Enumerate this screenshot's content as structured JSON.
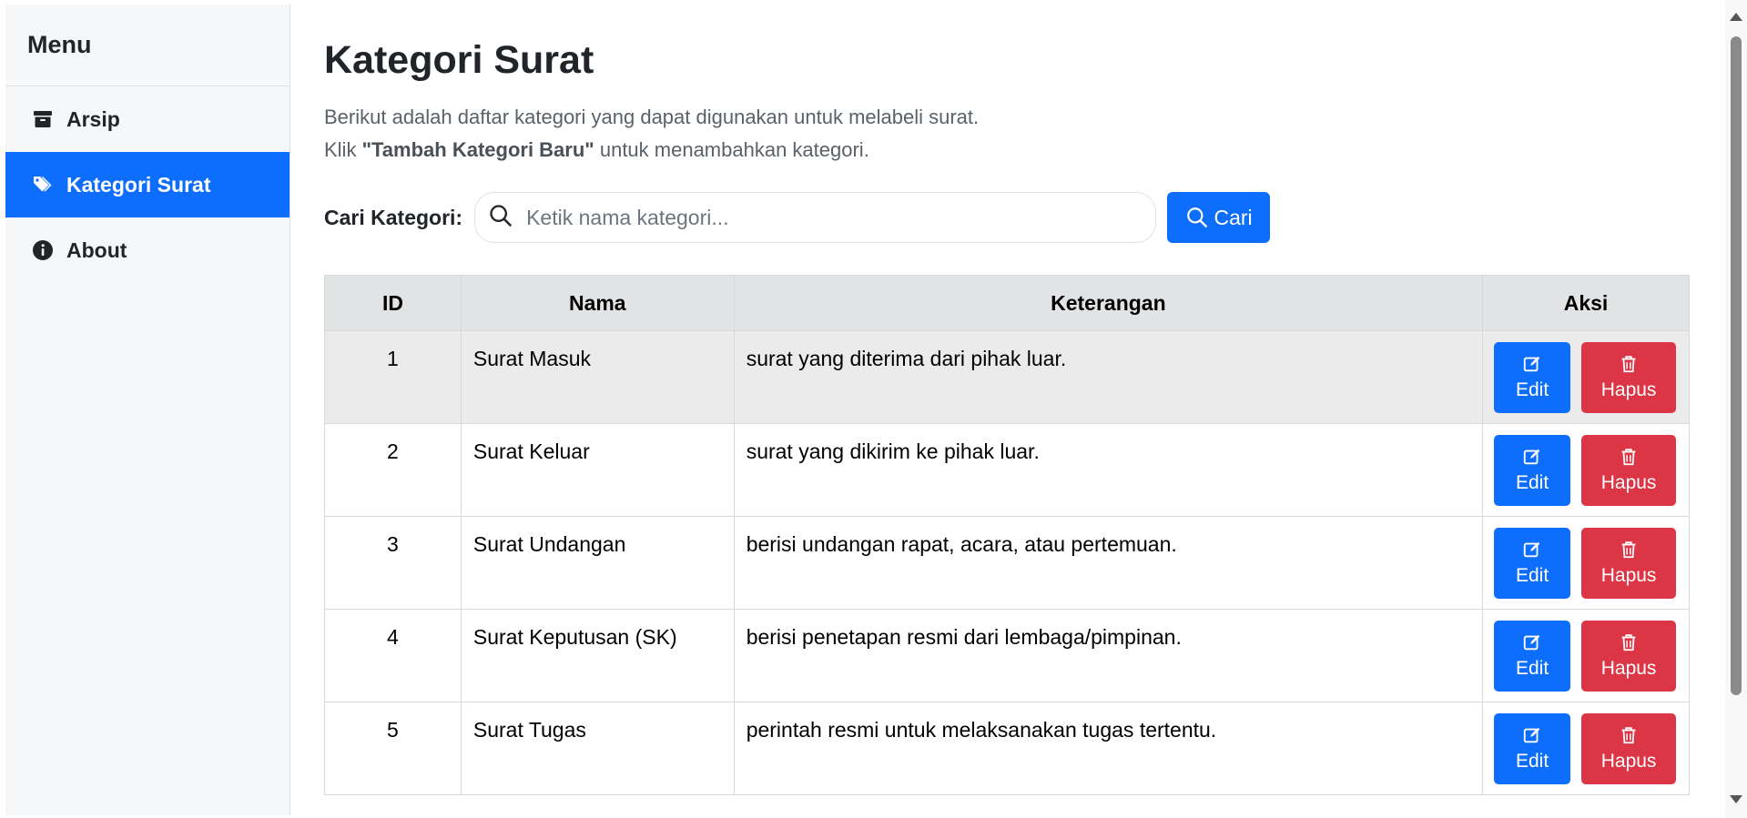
{
  "sidebar": {
    "title": "Menu",
    "items": [
      {
        "label": "Arsip",
        "icon": "archive-icon",
        "active": false
      },
      {
        "label": "Kategori Surat",
        "icon": "tags-icon",
        "active": true
      },
      {
        "label": "About",
        "icon": "info-icon",
        "active": false
      }
    ]
  },
  "main": {
    "title": "Kategori Surat",
    "description_line1": "Berikut adalah daftar kategori yang dapat digunakan untuk melabeli surat.",
    "description_line2_prefix": "Klik ",
    "description_line2_bold": "\"Tambah Kategori Baru\"",
    "description_line2_suffix": " untuk menambahkan kategori."
  },
  "search": {
    "label": "Cari Kategori:",
    "placeholder": "Ketik nama kategori...",
    "value": "",
    "button_label": "Cari"
  },
  "table": {
    "headers": [
      "ID",
      "Nama",
      "Keterangan",
      "Aksi"
    ],
    "rows": [
      {
        "id": "1",
        "nama": "Surat Masuk",
        "keterangan": "surat yang diterima dari pihak luar."
      },
      {
        "id": "2",
        "nama": "Surat Keluar",
        "keterangan": "surat yang dikirim ke pihak luar."
      },
      {
        "id": "3",
        "nama": "Surat Undangan",
        "keterangan": "berisi undangan rapat, acara, atau pertemuan."
      },
      {
        "id": "4",
        "nama": "Surat Keputusan (SK)",
        "keterangan": "berisi penetapan resmi dari lembaga/pimpinan."
      },
      {
        "id": "5",
        "nama": "Surat Tugas",
        "keterangan": "perintah resmi untuk melaksanakan tugas tertentu."
      }
    ],
    "edit_label": "Edit",
    "delete_label": "Hapus"
  },
  "colors": {
    "primary": "#0d6efd",
    "danger": "#dc3545",
    "sidebar_bg": "#f5f7f9",
    "header_bg": "#e2e3e5"
  }
}
